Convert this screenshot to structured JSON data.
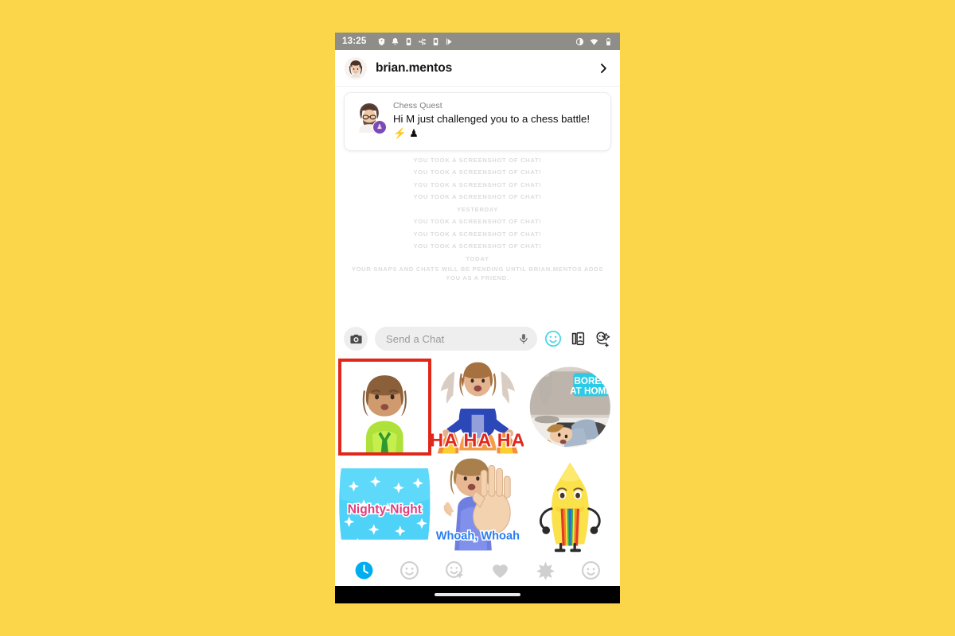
{
  "page": {
    "background_color": "#FBD64A",
    "accent_red": "#E0271A",
    "accent_blue": "#00ADEF",
    "accent_cyan": "#3FD4E8"
  },
  "status_bar": {
    "time": "13:25",
    "left_icons": [
      "shield-icon",
      "alarm-bell-icon",
      "sim-card-icon",
      "bluetooth-share-icon",
      "sim-card-icon",
      "play-icon"
    ],
    "right_icons": [
      "do-not-disturb-icon",
      "wifi-icon",
      "battery-icon"
    ],
    "background_color": "#8E8D87"
  },
  "header": {
    "avatar": "bitmoji-avatar",
    "username": "brian.mentos",
    "chevron": "chevron-right-icon"
  },
  "conversation": {
    "notification": {
      "avatar": "bitmoji-bearded-avatar",
      "badge": "chess-badge-icon",
      "title": "Chess Quest",
      "body": "Hi M just challenged you to a chess battle! ⚡ ♟"
    },
    "system_lines": [
      "YOU TOOK A SCREENSHOT OF CHAT!",
      "YOU TOOK A SCREENSHOT OF CHAT!",
      "YOU TOOK A SCREENSHOT OF CHAT!",
      "YOU TOOK A SCREENSHOT OF CHAT!"
    ],
    "day_divider_1": "YESTERDAY",
    "system_lines_2": [
      "YOU TOOK A SCREENSHOT OF CHAT!",
      "YOU TOOK A SCREENSHOT OF CHAT!",
      "YOU TOOK A SCREENSHOT OF CHAT!"
    ],
    "day_divider_2": "TODAY",
    "pending_notice": "YOUR SNAPS AND CHATS WILL BE PENDING UNTIL BRIAN.MENTOS ADDS YOU AS A FRIEND."
  },
  "input_bar": {
    "camera_icon": "camera-icon",
    "placeholder": "Send a Chat",
    "mic_icon": "microphone-icon",
    "sticker_icon": "smiley-sticker-icon",
    "cards_icon": "cameo-cards-icon",
    "bitmoji_icon": "bitmoji-sticker-icon"
  },
  "sticker_grid": {
    "selected_index": 0,
    "items": [
      {
        "name": "bitmoji-green-shirt",
        "caption": "",
        "selected": true
      },
      {
        "name": "bitmoji-ha-ha-ha",
        "caption": "HA HA HA",
        "selected": false
      },
      {
        "name": "bitmoji-bored-at-home",
        "caption": "BORED AT HOME",
        "selected": false
      },
      {
        "name": "bitmoji-nighty-night",
        "caption": "Nighty-Night",
        "selected": false
      },
      {
        "name": "bitmoji-whoah-whoah",
        "caption": "Whoah, Whoah",
        "selected": false
      },
      {
        "name": "bitmoji-rainbow-puke",
        "caption": "",
        "selected": false
      }
    ]
  },
  "bottom_tabs": {
    "active_index": 0,
    "items": [
      {
        "name": "recent-clock-icon",
        "active": true
      },
      {
        "name": "smiley-icon",
        "active": false
      },
      {
        "name": "smiley-star-icon",
        "active": false
      },
      {
        "name": "heart-icon",
        "active": false
      },
      {
        "name": "star-burst-icon",
        "active": false
      },
      {
        "name": "smiley-emoji-icon",
        "active": false
      }
    ]
  },
  "nav_bar": {
    "home_indicator": "home-indicator-pill"
  }
}
